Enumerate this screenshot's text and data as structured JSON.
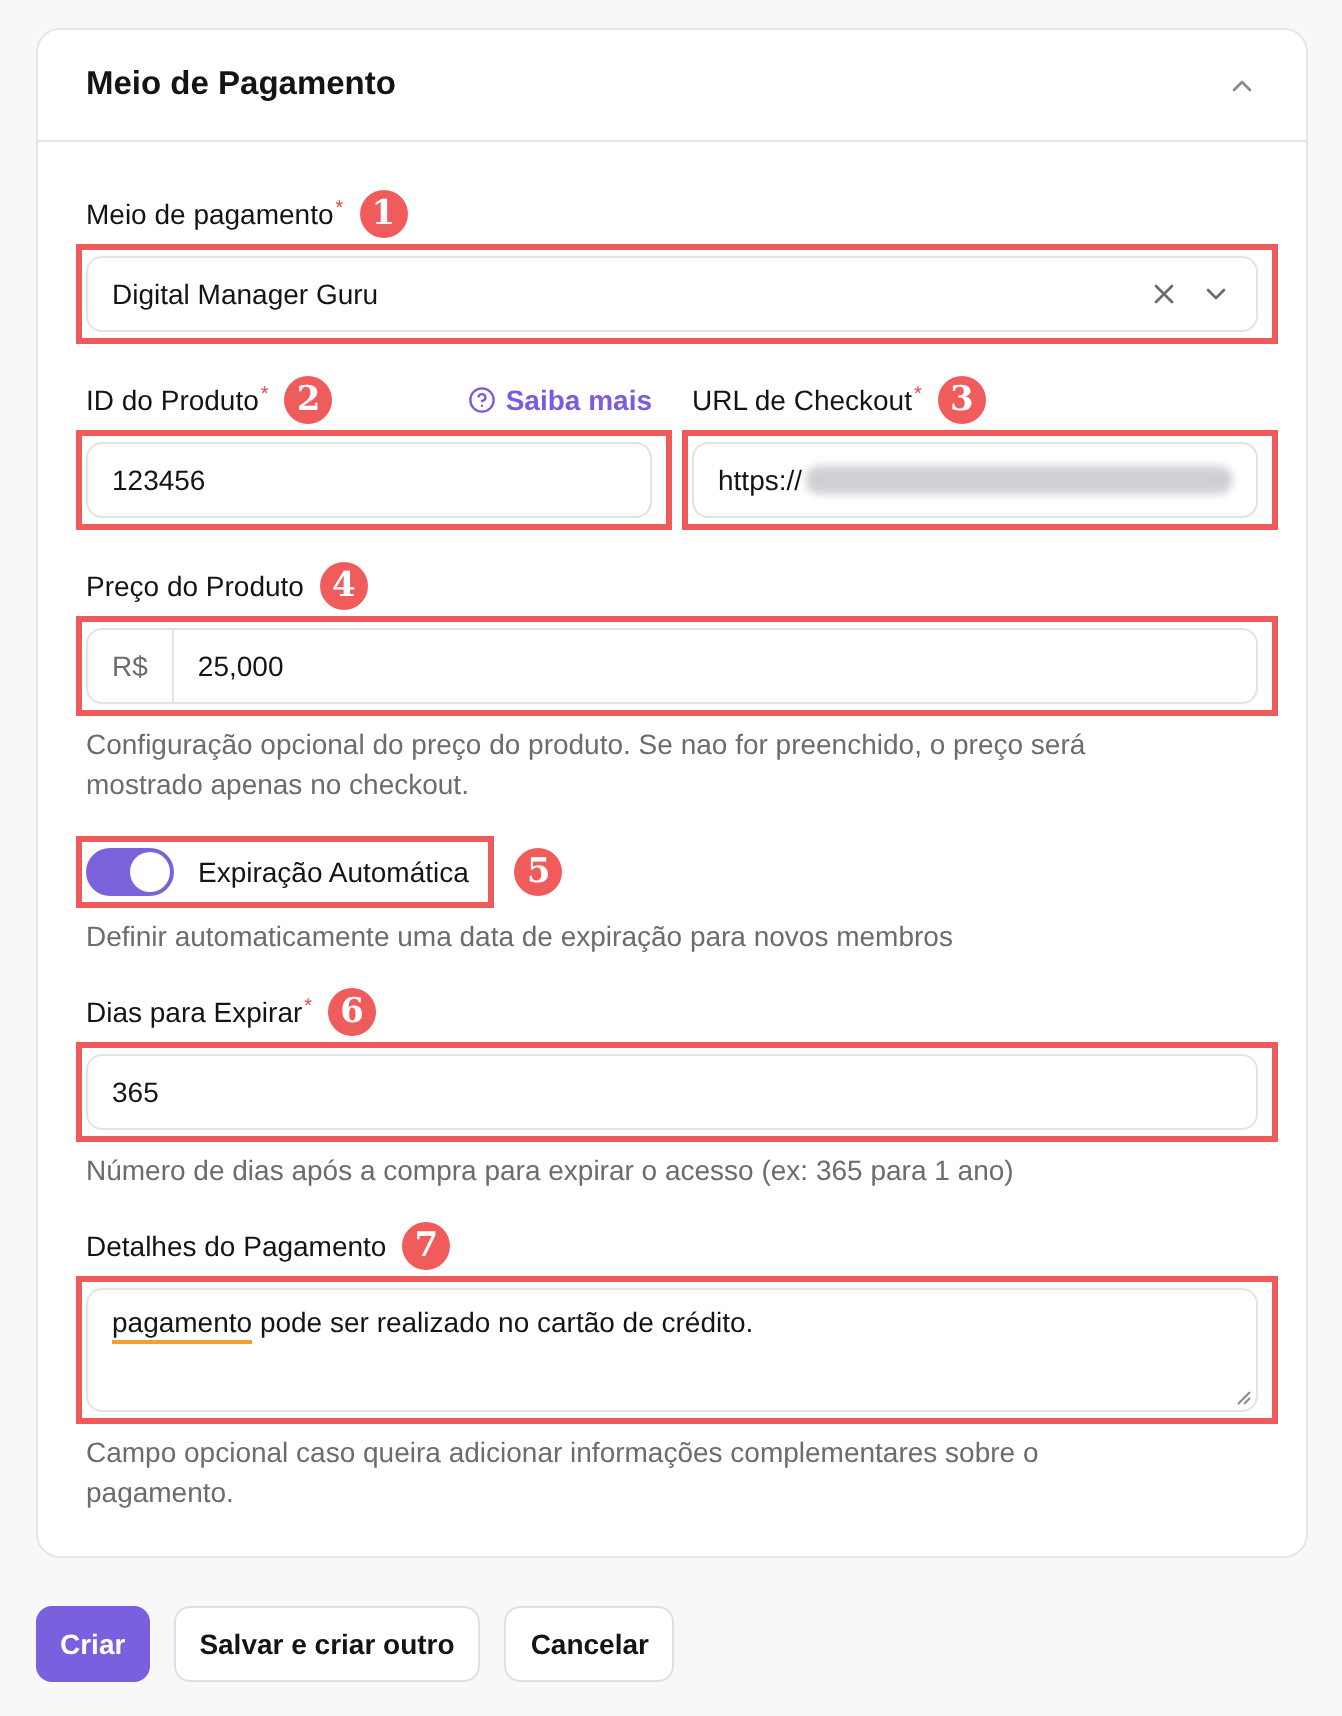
{
  "section": {
    "title": "Meio de Pagamento",
    "expanded": true
  },
  "form": [
    {
      "kind": "select",
      "label": "Meio de pagamento$^{*}$",
      "callout": "1",
      "highlighted": true,
      "value": "Digital Manager Guru"
    },
    {
      "kind": "row",
      "items": [
        {
          "kind": "text",
          "label": "ID do Produto$^{*}$",
          "callout": "2",
          "highlighted": true,
          "link": "Saiba mais",
          "value": "123456"
        },
        {
          "kind": "text",
          "label": "URL de Checkout$^{*}$",
          "callout": "3",
          "highlighted": true,
          "value": "https://",
          "blurred": true
        }
      ]
    },
    {
      "kind": "prefixed",
      "label": "Preço do Produto",
      "callout": "4",
      "highlighted": true,
      "prefix": "R$",
      "value": "25,000",
      "help": "Configuração opcional do preço do produto. Se nao for preenchido, o preço será mostrado apenas no checkout."
    },
    {
      "kind": "toggle",
      "label": "Expiração Automática",
      "callout": "5",
      "highlighted": true,
      "on": true,
      "help": "Definir automaticamente uma data de expiração para novos membros"
    },
    {
      "kind": "text",
      "label": "Dias para Expirar$^{*}$",
      "callout": "6",
      "highlighted": true,
      "value": "365",
      "help": "Número de dias após a compra para expirar o acesso (ex: 365 para 1 ano)"
    },
    {
      "kind": "textarea",
      "label": "Detalhes do Pagamento",
      "callout": "7",
      "highlighted": true,
      "value_parts": [
        {
          "text": "pagamento",
          "flagged": true
        },
        {
          "text": " pode ser realizado no cartão de crédito.",
          "flagged": false
        }
      ],
      "help": "Campo opcional caso queira adicionar informações complementares sobre o pagamento."
    }
  ],
  "buttons": [
    {
      "label": "Criar",
      "kind": "primary"
    },
    {
      "label": "Salvar e criar outro",
      "kind": "secondary"
    },
    {
      "label": "Cancelar",
      "kind": "secondary"
    }
  ]
}
